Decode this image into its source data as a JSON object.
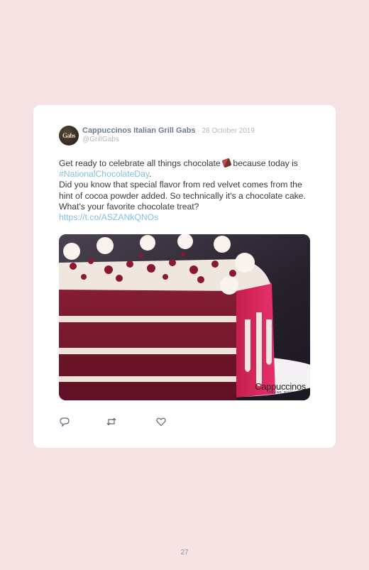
{
  "tweet": {
    "avatar_text": "Gabs",
    "author_name": "Cappuccinos Italian Grill Gabs",
    "date_separator": " · ",
    "date": "28 October 2019",
    "handle": "@GrillGabs",
    "text_part1": "Get ready to celebrate all things chocolate ",
    "text_part2": " because today is ",
    "hashtag": "#NationalChocolateDay",
    "text_part3": ".",
    "text_line2": "Did you know that special flavor from red velvet comes from the hint of cocoa powder added. So technically it's a chocolate cake. What's your favorite chocolate treat?",
    "link": "https://t.co/ASZANkQNOs",
    "image": {
      "watermark_brand": "Cappuccinos",
      "watermark_sub": "italian grill"
    }
  },
  "actions": {
    "reply_icon": "reply-icon",
    "retweet_icon": "retweet-icon",
    "like_icon": "heart-icon"
  },
  "page": {
    "number": "27"
  }
}
